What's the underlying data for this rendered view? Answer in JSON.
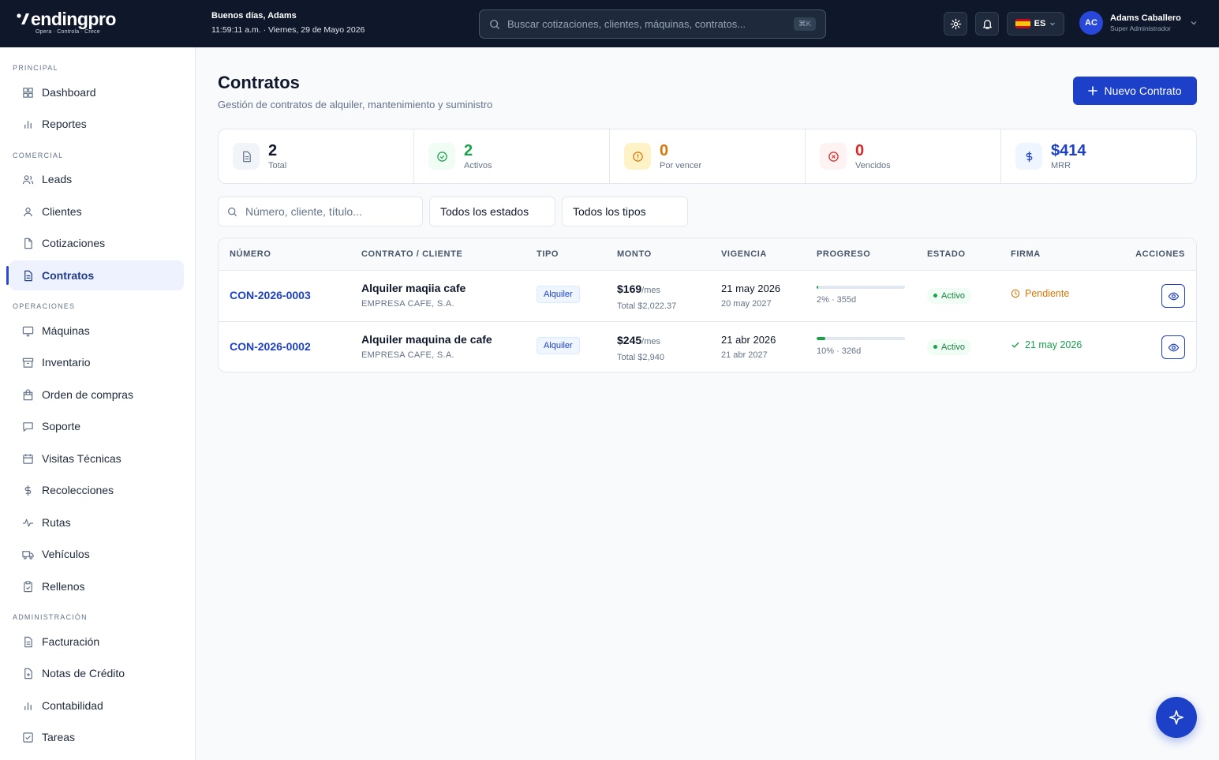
{
  "brand": {
    "name": "endingpro",
    "tagline": "Opera · Controla · Crece"
  },
  "greeting": {
    "title": "Buenos días, Adams",
    "datetime": "11:59:11 a.m. · Viernes, 29 de Mayo 2026"
  },
  "search": {
    "placeholder": "Buscar cotizaciones, clientes, máquinas, contratos...",
    "shortcut": "⌘K"
  },
  "language": {
    "code": "ES"
  },
  "user": {
    "initials": "AC",
    "name": "Adams Caballero",
    "role": "Super Administrador"
  },
  "sidebar": {
    "sections": [
      {
        "title": "PRINCIPAL",
        "items": [
          {
            "label": "Dashboard",
            "icon": "grid-icon"
          },
          {
            "label": "Reportes",
            "icon": "bar-chart-icon"
          }
        ]
      },
      {
        "title": "COMERCIAL",
        "items": [
          {
            "label": "Leads",
            "icon": "users-icon"
          },
          {
            "label": "Clientes",
            "icon": "user-icon"
          },
          {
            "label": "Cotizaciones",
            "icon": "file-icon"
          },
          {
            "label": "Contratos",
            "icon": "file-text-icon",
            "active": true
          }
        ]
      },
      {
        "title": "OPERACIONES",
        "items": [
          {
            "label": "Máquinas",
            "icon": "monitor-icon"
          },
          {
            "label": "Inventario",
            "icon": "archive-icon"
          },
          {
            "label": "Orden de compras",
            "icon": "shopping-bag-icon"
          },
          {
            "label": "Soporte",
            "icon": "message-icon"
          },
          {
            "label": "Visitas Técnicas",
            "icon": "calendar-icon"
          },
          {
            "label": "Recolecciones",
            "icon": "dollar-icon"
          },
          {
            "label": "Rutas",
            "icon": "activity-icon"
          },
          {
            "label": "Vehículos",
            "icon": "truck-icon"
          },
          {
            "label": "Rellenos",
            "icon": "clipboard-icon"
          }
        ]
      },
      {
        "title": "ADMINISTRACIÓN",
        "items": [
          {
            "label": "Facturación",
            "icon": "file-text-icon"
          },
          {
            "label": "Notas de Crédito",
            "icon": "file-plus-icon"
          },
          {
            "label": "Contabilidad",
            "icon": "bar-chart-icon"
          },
          {
            "label": "Tareas",
            "icon": "check-square-icon"
          }
        ]
      }
    ]
  },
  "page": {
    "title": "Contratos",
    "subtitle": "Gestión de contratos de alquiler, mantenimiento y suministro",
    "new_button": "Nuevo Contrato"
  },
  "stats": [
    {
      "value": "2",
      "label": "Total",
      "color": "#0f172a",
      "bg": "#f1f5f9",
      "icon": "file-icon"
    },
    {
      "value": "2",
      "label": "Activos",
      "color": "#16a34a",
      "bg": "#f0fdf4",
      "icon": "check-circle-icon"
    },
    {
      "value": "0",
      "label": "Por vencer",
      "color": "#d97706",
      "bg": "#fef3c7",
      "icon": "alert-circle-icon"
    },
    {
      "value": "0",
      "label": "Vencidos",
      "color": "#dc2626",
      "bg": "#fef2f2",
      "icon": "x-circle-icon"
    },
    {
      "value": "$414",
      "label": "MRR",
      "color": "#1d40c8",
      "bg": "#eff6ff",
      "icon": "dollar-icon"
    }
  ],
  "filters": {
    "search_placeholder": "Número, cliente, título...",
    "status": "Todos los estados",
    "type": "Todos los tipos"
  },
  "table": {
    "headers": [
      "NÚMERO",
      "CONTRATO / CLIENTE",
      "TIPO",
      "MONTO",
      "VIGENCIA",
      "PROGRESO",
      "ESTADO",
      "FIRMA",
      "ACCIONES"
    ],
    "rows": [
      {
        "number": "CON-2026-0003",
        "title": "Alquiler maqiia cafe",
        "client": "EMPRESA CAFE, S.A.",
        "type": "Alquiler",
        "amount": "$169",
        "period": "/mes",
        "total": "Total $2,022.37",
        "start": "21 may 2026",
        "end": "20 may 2027",
        "progress": 2,
        "progress_label": "2% · 355d",
        "status": "Activo",
        "signature": "Pendiente",
        "signature_color": "#d97706"
      },
      {
        "number": "CON-2026-0002",
        "title": "Alquiler maquina de cafe",
        "client": "EMPRESA CAFE, S.A.",
        "type": "Alquiler",
        "amount": "$245",
        "period": "/mes",
        "total": "Total $2,940",
        "start": "21 abr 2026",
        "end": "21 abr 2027",
        "progress": 10,
        "progress_label": "10% · 326d",
        "status": "Activo",
        "signature": "21 may 2026",
        "signature_color": "#16a34a"
      }
    ]
  }
}
